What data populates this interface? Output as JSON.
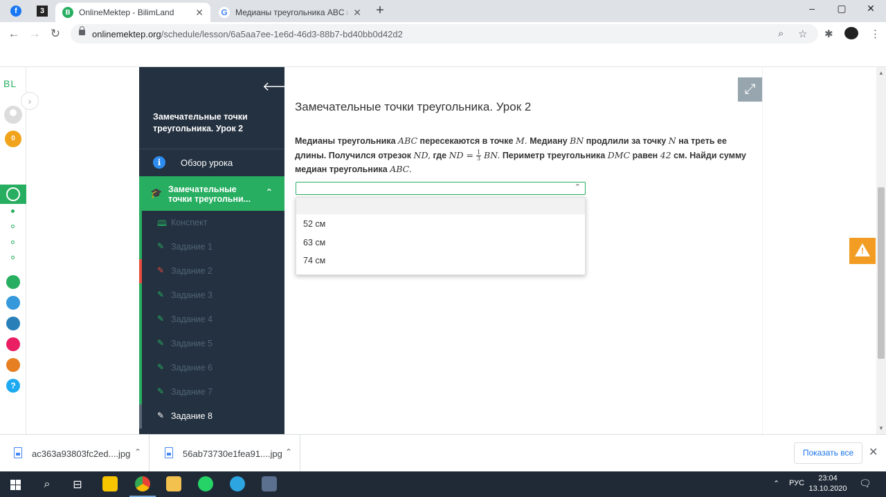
{
  "browser": {
    "tabs": [
      {
        "title": "OnlineMektep - BilimLand",
        "close": "✕",
        "active": true
      },
      {
        "title": "Медианы треугольника ABC пер",
        "close": "✕",
        "active": false
      }
    ],
    "new_tab": "+",
    "window_controls": {
      "minimize": "–",
      "maximize": "▢",
      "close": "✕"
    },
    "url_host": "onlinemektep.org",
    "url_path": "/schedule/lesson/6a5aa7ee-1e6d-46d3-88b7-bd40bb0d42d2"
  },
  "leftbar": {
    "logo": "BL",
    "coins": "0"
  },
  "sidebar": {
    "back_icon": "arrow-left-icon",
    "lesson_title": "Замечательные точки треугольника. Урок 2",
    "overview_label": "Обзор урока",
    "section_label_line1": "Замечательные",
    "section_label_line2": "точки треугольни...",
    "items": [
      {
        "label": "Конспект",
        "state": "done"
      },
      {
        "label": "Задание 1",
        "state": "done"
      },
      {
        "label": "Задание 2",
        "state": "wrong"
      },
      {
        "label": "Задание 3",
        "state": "done"
      },
      {
        "label": "Задание 4",
        "state": "done"
      },
      {
        "label": "Задание 5",
        "state": "done"
      },
      {
        "label": "Задание 6",
        "state": "done"
      },
      {
        "label": "Задание 7",
        "state": "done"
      },
      {
        "label": "Задание 8",
        "state": "current"
      }
    ]
  },
  "main": {
    "title": "Замечательные точки треугольника. Урок 2",
    "question": {
      "p1": "Медианы треугольника ",
      "m1": "ABC",
      "p2": " пересекаются в точке ",
      "m2": "M.",
      "p3": " Медиану ",
      "m3": "BN",
      "p4": " продлили за точку ",
      "m4": "N",
      "p5": " на треть ее длины. Получился отрезок ",
      "m5": "ND,",
      "p6": " где ",
      "m6": "ND = ",
      "frac_num": "1",
      "frac_den": "3",
      "m7": " BN.",
      "p7": " Периметр треугольника ",
      "m8": "DMC",
      "p8": " равен ",
      "m9": "42",
      "p9": " см. Найди сумму медиан треугольника ",
      "m10": "ABC."
    },
    "select_value": "",
    "options": [
      "",
      "52 см",
      "63 см",
      "74 см"
    ]
  },
  "downloads": {
    "files": [
      "ac363a93803fc2ed....jpg",
      "56ab73730e1fea91....jpg"
    ],
    "show_all": "Показать все"
  },
  "taskbar": {
    "lang": "РУС",
    "time": "23:04",
    "date": "13.10.2020"
  },
  "colors": {
    "accent_green": "#27ae60",
    "sidebar_bg": "#243140",
    "wrong_red": "#e74c3c",
    "warn_orange": "#f39c24"
  }
}
